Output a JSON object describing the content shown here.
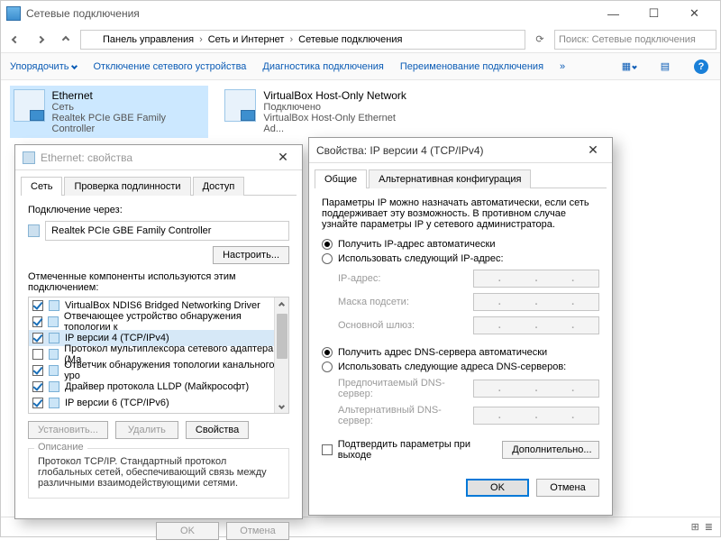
{
  "explorer": {
    "title": "Сетевые подключения",
    "breadcrumb": [
      "Панель управления",
      "Сеть и Интернет",
      "Сетевые подключения"
    ],
    "search_placeholder": "Поиск: Сетевые подключения",
    "toolbar": {
      "organize": "Упорядочить",
      "disable": "Отключение сетевого устройства",
      "diagnose": "Диагностика подключения",
      "rename": "Переименование подключения"
    },
    "connections": [
      {
        "name": "Ethernet",
        "status": "Сеть",
        "device": "Realtek PCIe GBE Family Controller",
        "selected": true
      },
      {
        "name": "VirtualBox Host-Only Network",
        "status": "Подключено",
        "device": "VirtualBox Host-Only Ethernet Ad...",
        "selected": false
      }
    ]
  },
  "eth_dialog": {
    "title": "Ethernet: свойства",
    "tabs": [
      "Сеть",
      "Проверка подлинности",
      "Доступ"
    ],
    "connect_label": "Подключение через:",
    "adapter": "Realtek PCIe GBE Family Controller",
    "configure_btn": "Настроить...",
    "items_label": "Отмеченные компоненты используются этим подключением:",
    "items": [
      {
        "checked": true,
        "label": "VirtualBox NDIS6 Bridged Networking Driver"
      },
      {
        "checked": true,
        "label": "Отвечающее устройство обнаружения топологии к"
      },
      {
        "checked": true,
        "label": "IP версии 4 (TCP/IPv4)",
        "selected": true
      },
      {
        "checked": false,
        "label": "Протокол мультиплексора сетевого адаптера (Ма"
      },
      {
        "checked": true,
        "label": "Ответчик обнаружения топологии канального уро"
      },
      {
        "checked": true,
        "label": "Драйвер протокола LLDP (Майкрософт)"
      },
      {
        "checked": true,
        "label": "IP версии 6 (TCP/IPv6)"
      }
    ],
    "install_btn": "Установить...",
    "uninstall_btn": "Удалить",
    "props_btn": "Свойства",
    "desc_head": "Описание",
    "desc_body": "Протокол TCP/IP. Стандартный протокол глобальных сетей, обеспечивающий связь между различными взаимодействующими сетями.",
    "ok": "OK",
    "cancel": "Отмена"
  },
  "ip_dialog": {
    "title": "Свойства: IP версии 4 (TCP/IPv4)",
    "tabs": [
      "Общие",
      "Альтернативная конфигурация"
    ],
    "intro": "Параметры IP можно назначать автоматически, если сеть поддерживает эту возможность. В противном случае узнайте параметры IP у сетевого администратора.",
    "r_ip_auto": "Получить IP-адрес автоматически",
    "r_ip_manual": "Использовать следующий IP-адрес:",
    "ip_label": "IP-адрес:",
    "mask_label": "Маска подсети:",
    "gw_label": "Основной шлюз:",
    "r_dns_auto": "Получить адрес DNS-сервера автоматически",
    "r_dns_manual": "Использовать следующие адреса DNS-серверов:",
    "dns1_label": "Предпочитаемый DNS-сервер:",
    "dns2_label": "Альтернативный DNS-сервер:",
    "confirm_exit": "Подтвердить параметры при выходе",
    "advanced": "Дополнительно...",
    "ok": "OK",
    "cancel": "Отмена"
  }
}
